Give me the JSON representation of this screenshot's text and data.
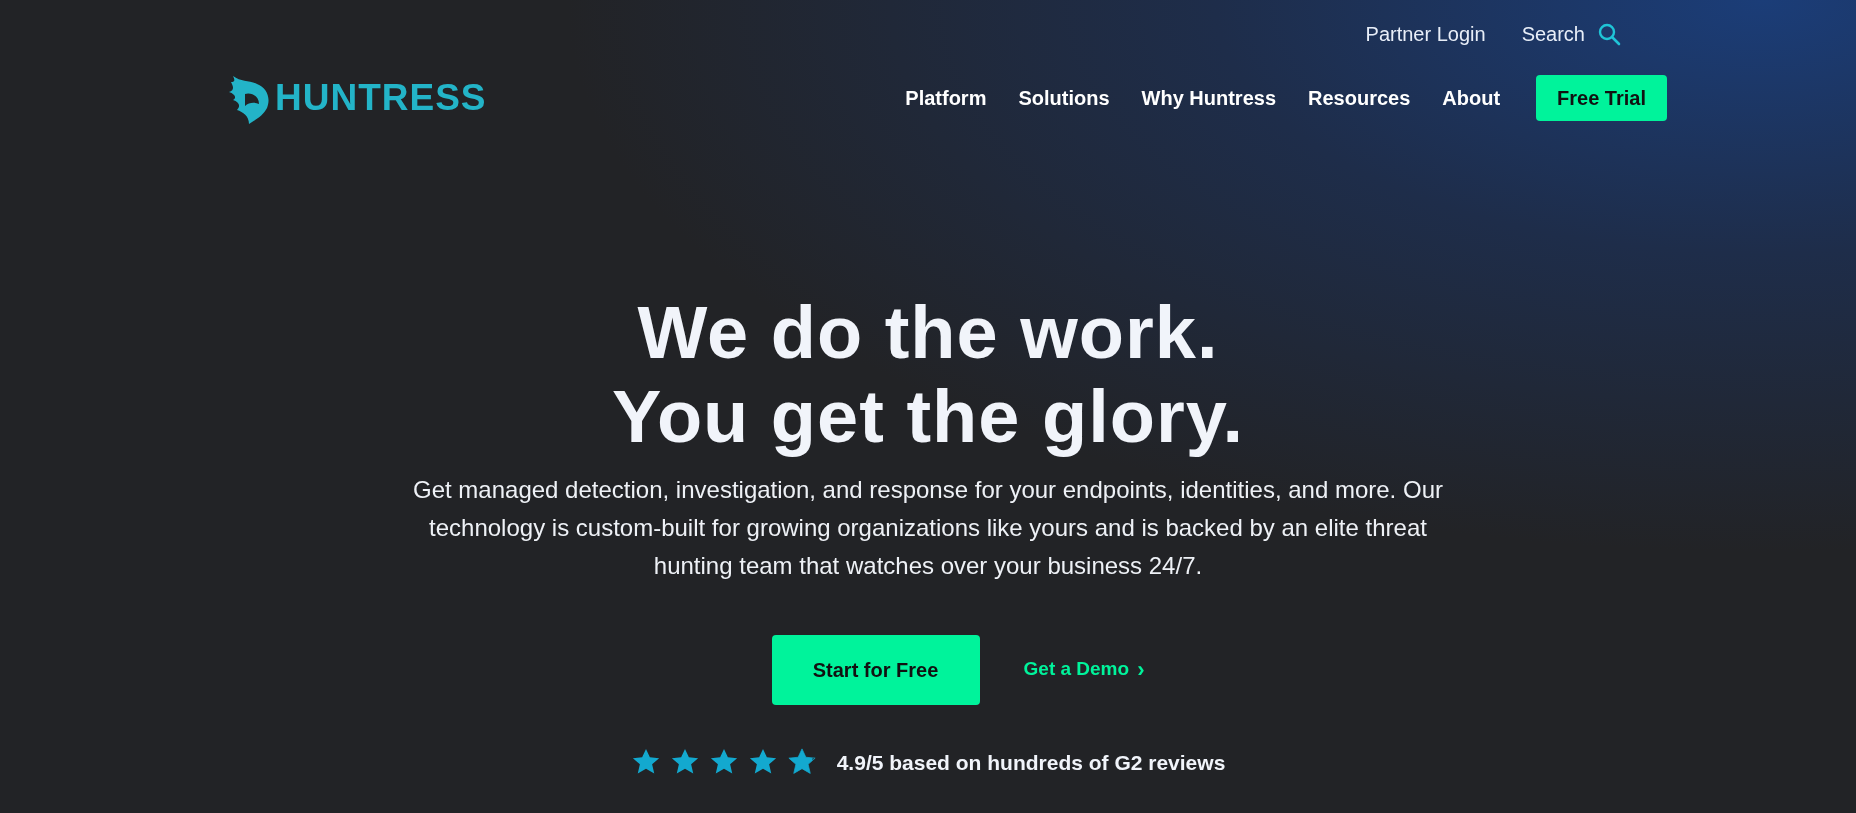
{
  "logo": {
    "text": "HUNTRESS"
  },
  "utility_links": [
    {
      "label": "Partner Login"
    },
    {
      "label": "Search"
    }
  ],
  "nav": [
    {
      "label": "Platform"
    },
    {
      "label": "Solutions"
    },
    {
      "label": "Why Huntress"
    },
    {
      "label": "Resources"
    },
    {
      "label": "About"
    }
  ],
  "nav_button": "Free Trial",
  "hero": {
    "headline": [
      "We do the work.",
      "You get the glory."
    ],
    "description": "Get managed detection, investigation, and response for your endpoints, identities, and more. Our technology is custom-built for growing organizations like yours and is backed by an elite threat hunting team that watches over your business 24/7.",
    "primary_button": "Start for Free",
    "secondary_link": "Get a Demo",
    "secondary_link_icon": "›",
    "rating": {
      "stars": 4.9,
      "text": "4.9/5 based on hundreds of G2 reviews"
    }
  }
}
